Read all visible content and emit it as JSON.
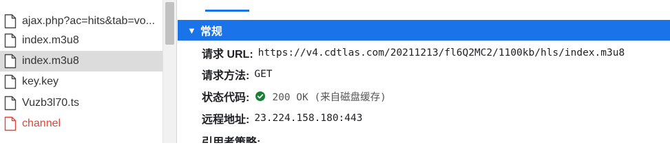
{
  "requests": [
    {
      "name": "ajax.php?ac=hits&tab=vo...",
      "selected": false,
      "error": false
    },
    {
      "name": "index.m3u8",
      "selected": false,
      "error": false
    },
    {
      "name": "index.m3u8",
      "selected": true,
      "error": false
    },
    {
      "name": "key.key",
      "selected": false,
      "error": false
    },
    {
      "name": "Vuzb3l70.ts",
      "selected": false,
      "error": false
    },
    {
      "name": "channel",
      "selected": false,
      "error": true
    }
  ],
  "general": {
    "section_title": "常规",
    "request_url_label": "请求 URL:",
    "request_url": "https://v4.cdtlas.com/20211213/fl6Q2MC2/1100kb/hls/index.m3u8",
    "request_method_label": "请求方法:",
    "request_method": "GET",
    "status_code_label": "状态代码:",
    "status_code": "200 OK (来自磁盘缓存)",
    "remote_address_label": "远程地址:",
    "remote_address": "23.224.158.180:443",
    "referrer_policy_label": "引用者策略:"
  },
  "colors": {
    "accent": "#1a73e8",
    "ok": "#188038",
    "error": "#e0453a",
    "selected": "#dcdcdc"
  }
}
